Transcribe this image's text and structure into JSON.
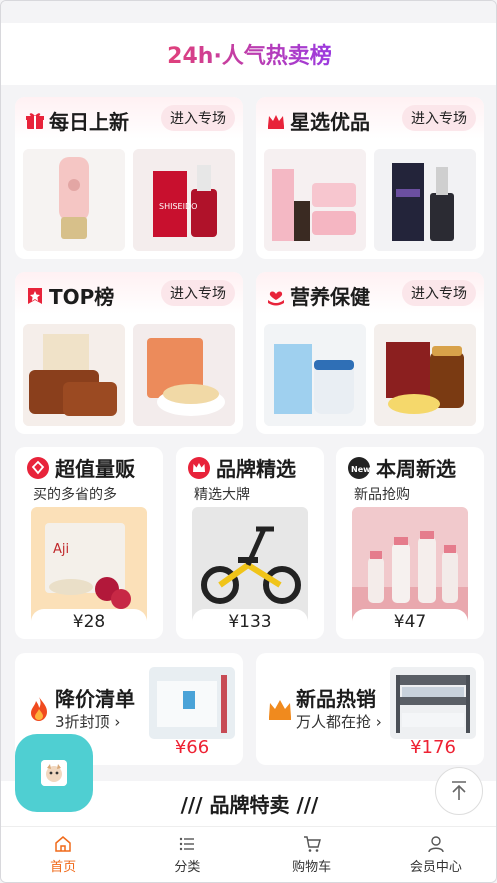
{
  "header": {
    "title": "24h·人气热卖榜"
  },
  "sections": [
    {
      "title": "每日上新",
      "button": "进入专场",
      "icon": "gift-icon"
    },
    {
      "title": "星选优品",
      "button": "进入专场",
      "icon": "crown-icon"
    },
    {
      "title": "TOP榜",
      "button": "进入专场",
      "icon": "top-badge-icon"
    },
    {
      "title": "营养保健",
      "button": "进入专场",
      "icon": "heart-hand-icon"
    }
  ],
  "minis": [
    {
      "title": "超值量贩",
      "subtitle": "买的多省的多",
      "price": "¥28",
      "icon": "tag-icon"
    },
    {
      "title": "品牌精选",
      "subtitle": "精选大牌",
      "price": "¥133",
      "icon": "crown-icon"
    },
    {
      "title": "本周新选",
      "subtitle": "新品抢购",
      "price": "¥47",
      "icon": "new-icon"
    }
  ],
  "promos": [
    {
      "title": "降价清单",
      "subtitle": "3折封顶",
      "price": "¥66",
      "icon": "flame-icon"
    },
    {
      "title": "新品热销",
      "subtitle": "万人都在抢",
      "price": "¥176",
      "icon": "crown-icon"
    }
  ],
  "brand": {
    "title": "/// 品牌特卖 ///"
  },
  "tabs": [
    {
      "label": "首页",
      "icon": "home-icon",
      "active": true
    },
    {
      "label": "分类",
      "icon": "list-icon",
      "active": false
    },
    {
      "label": "购物车",
      "icon": "cart-icon",
      "active": false
    },
    {
      "label": "会员中心",
      "icon": "user-icon",
      "active": false
    }
  ],
  "colors": {
    "accent": "#f06a1a",
    "price": "#ee2233",
    "float": "#4fcfd2",
    "title_from": "#e0407a",
    "title_to": "#9b3ae0"
  }
}
